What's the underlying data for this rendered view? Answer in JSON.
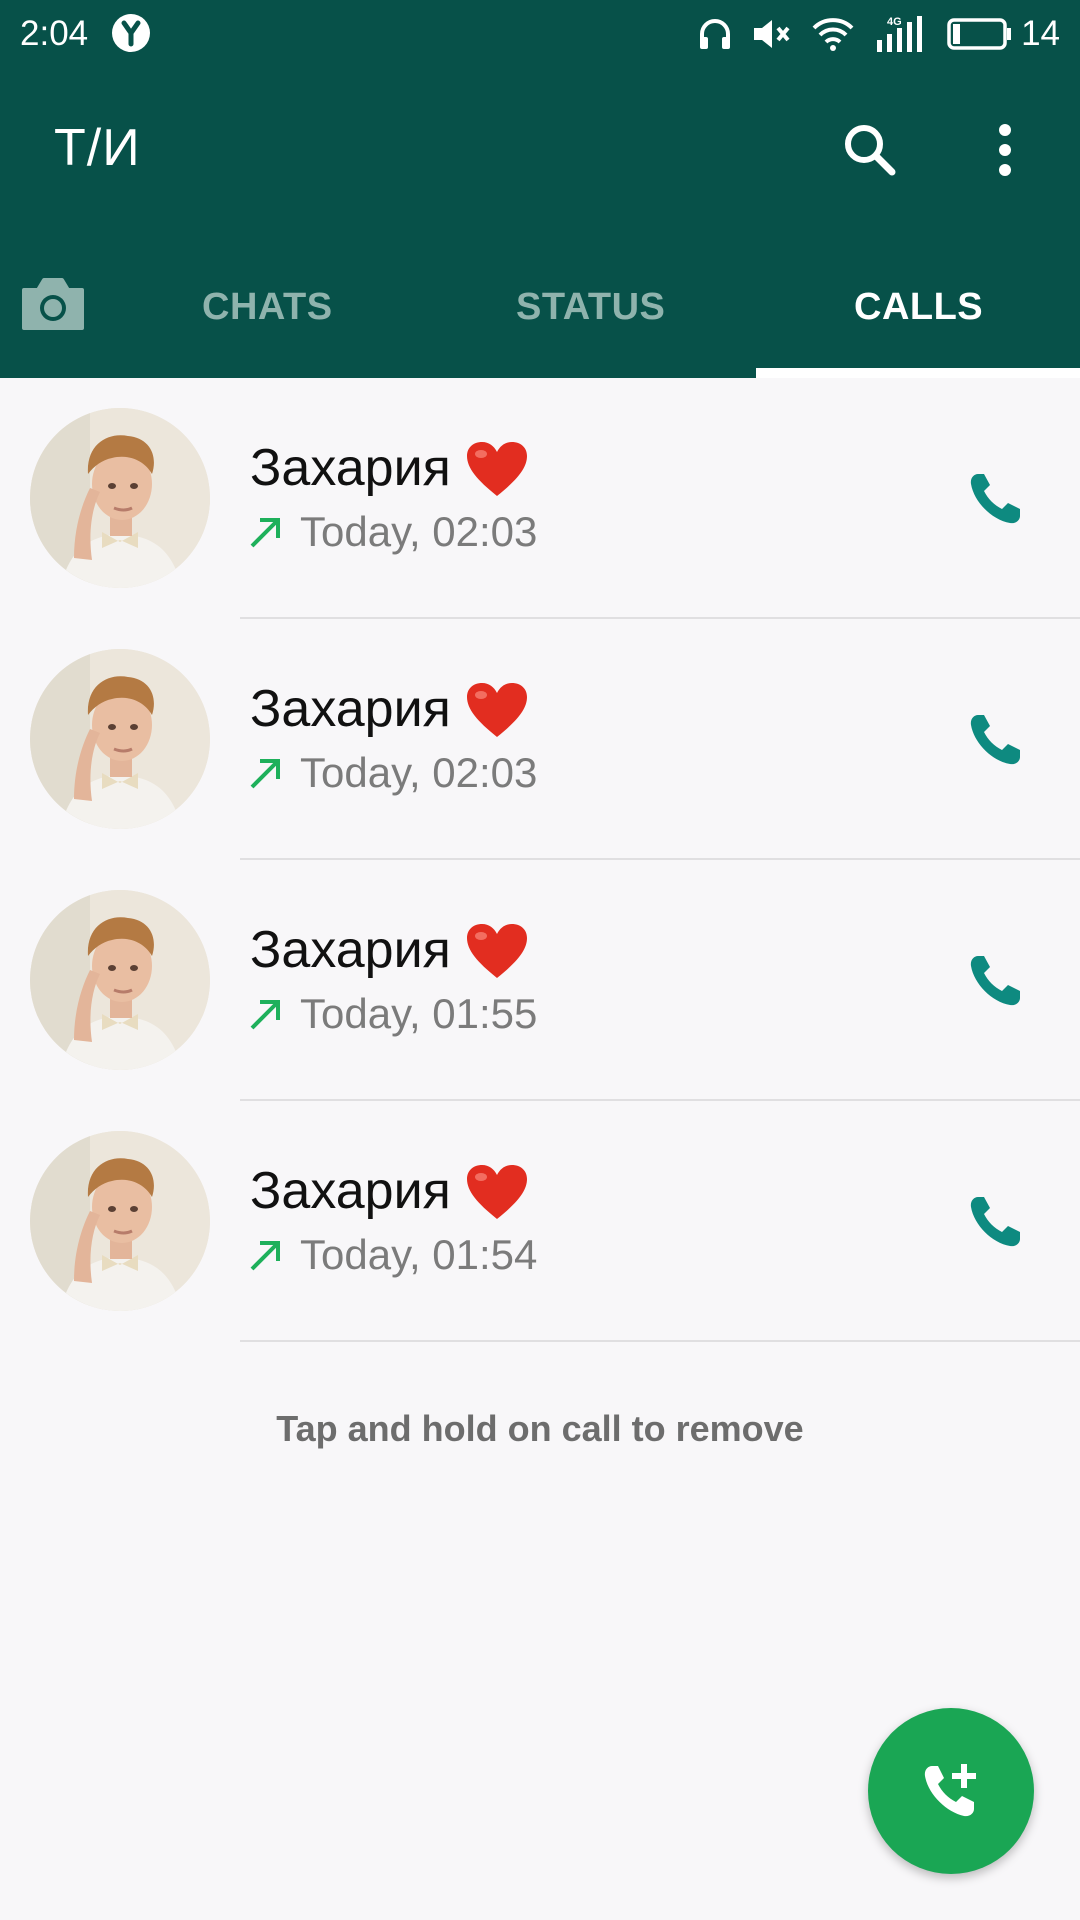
{
  "status_bar": {
    "time": "2:04",
    "battery_level": "14",
    "network_label": "4G"
  },
  "toolbar": {
    "title": "Т/И",
    "search_icon": "search-icon",
    "more_icon": "more-vert-icon"
  },
  "tabs": [
    {
      "label": "CHATS",
      "active": false
    },
    {
      "label": "STATUS",
      "active": false
    },
    {
      "label": "CALLS",
      "active": true
    }
  ],
  "calls": [
    {
      "name": "Захария",
      "time": "Today, 02:03",
      "direction": "outgoing"
    },
    {
      "name": "Захария",
      "time": "Today, 02:03",
      "direction": "outgoing"
    },
    {
      "name": "Захария",
      "time": "Today, 01:55",
      "direction": "outgoing"
    },
    {
      "name": "Захария",
      "time": "Today, 01:54",
      "direction": "outgoing"
    }
  ],
  "hint": "Tap and hold on call to remove",
  "fab_icon": "add-call-icon",
  "colors": {
    "header": "#075149",
    "accent_green": "#1aa654",
    "call_icon_teal": "#0e8a80",
    "outgoing_arrow": "#1eb05b"
  }
}
